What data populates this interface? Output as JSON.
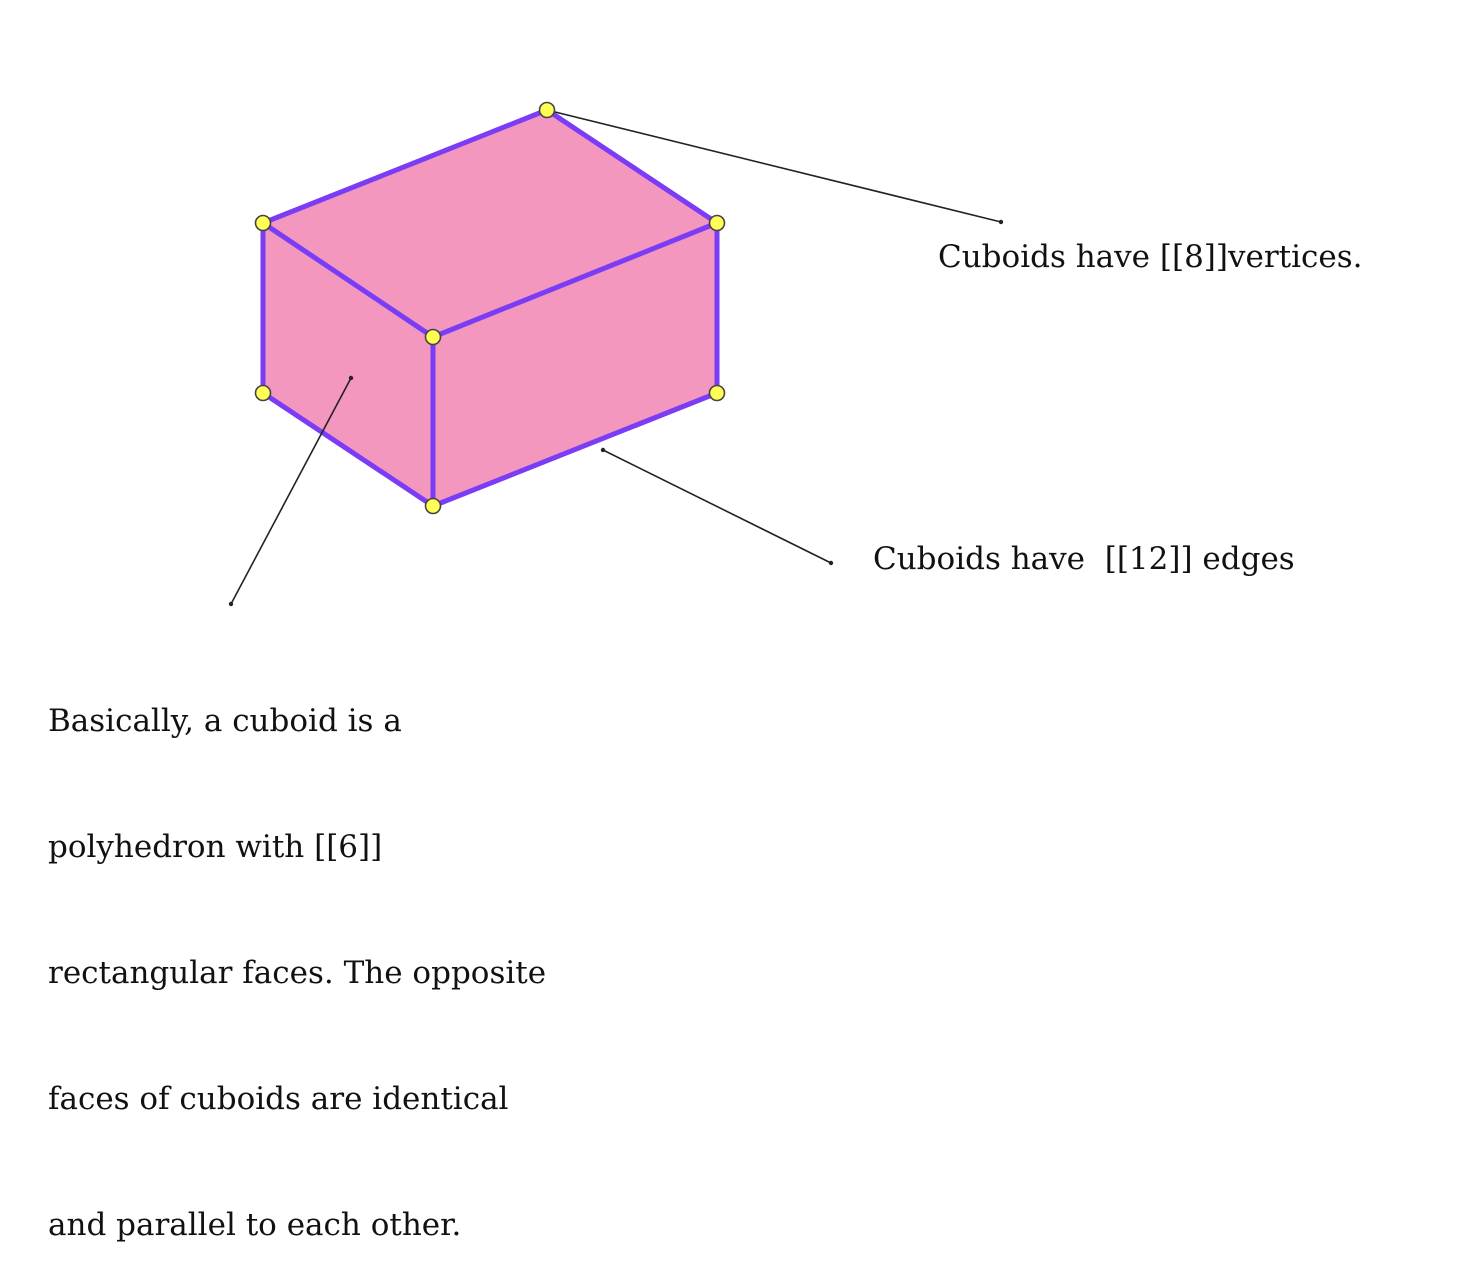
{
  "colors": {
    "face_fill": "#f397bf",
    "edge_stroke": "#7a3df5",
    "vertex_fill": "#ffff55",
    "vertex_stroke": "#444444",
    "leader_line": "#222222",
    "text": "#111111"
  },
  "annotations": {
    "vertices": "Cuboids have [[8]]vertices.",
    "edges": "Cuboids have  [[12]] edges",
    "faces_lines": [
      "Basically, a cuboid is a",
      "polyhedron with [[6]]",
      "rectangular faces. The opposite",
      "faces of cuboids are identical",
      "and parallel to each other."
    ]
  }
}
